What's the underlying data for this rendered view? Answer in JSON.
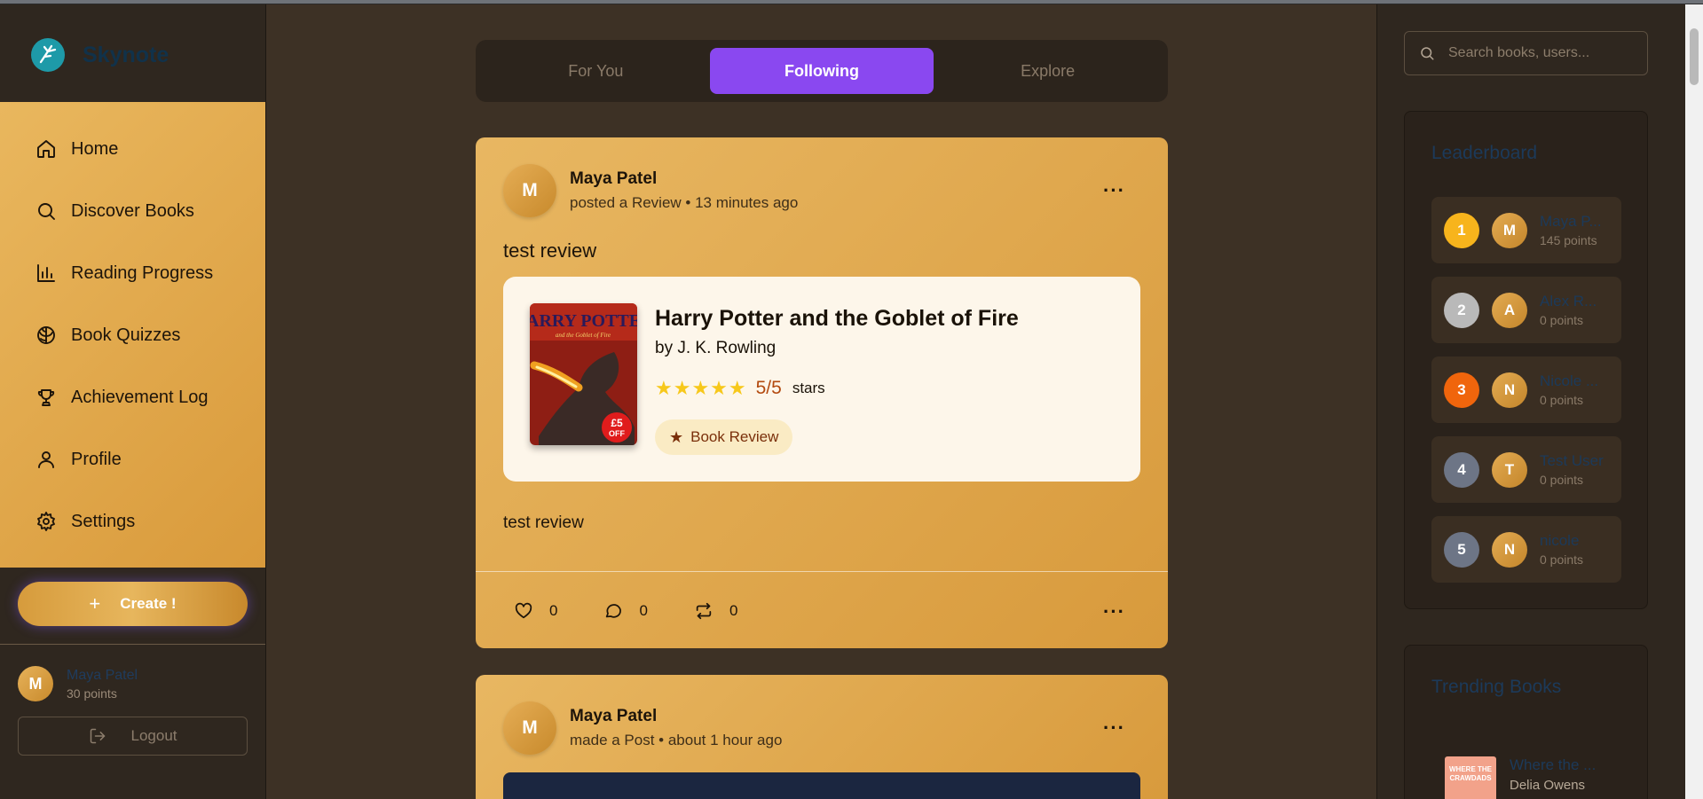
{
  "brand": {
    "name": "Skynote"
  },
  "nav": {
    "items": [
      {
        "label": "Home",
        "icon": "home-icon"
      },
      {
        "label": "Discover Books",
        "icon": "search-icon"
      },
      {
        "label": "Reading Progress",
        "icon": "bar-chart-icon"
      },
      {
        "label": "Book Quizzes",
        "icon": "brain-icon"
      },
      {
        "label": "Achievement Log",
        "icon": "trophy-icon"
      },
      {
        "label": "Profile",
        "icon": "user-icon"
      },
      {
        "label": "Settings",
        "icon": "gear-icon"
      }
    ]
  },
  "create_button": {
    "label": "Create !"
  },
  "current_user": {
    "initial": "M",
    "name": "Maya Patel",
    "points": "30 points"
  },
  "logout": {
    "label": "Logout"
  },
  "feed_tabs": [
    {
      "label": "For You",
      "active": false
    },
    {
      "label": "Following",
      "active": true
    },
    {
      "label": "Explore",
      "active": false
    }
  ],
  "posts": [
    {
      "initial": "M",
      "author": "Maya Patel",
      "subtitle": "posted a Review • 13 minutes ago",
      "title": "test review",
      "book": {
        "title": "Harry Potter and the Goblet of Fire",
        "author": "by J. K. Rowling",
        "stars": "★★★★★",
        "score": "5/5",
        "stars_label": "stars",
        "badge": "Book Review",
        "cover": {
          "top_text": "HARRY POTTER",
          "sub_text": "and the Goblet of Fire",
          "sticker_big": "£5",
          "sticker_small": "OFF"
        }
      },
      "body": "test review",
      "likes": "0",
      "comments": "0",
      "reposts": "0"
    },
    {
      "initial": "M",
      "author": "Maya Patel",
      "subtitle": "made a Post • about 1 hour ago"
    }
  ],
  "search": {
    "placeholder": "Search books, users..."
  },
  "leaderboard": {
    "title": "Leaderboard",
    "rows": [
      {
        "rank": "1",
        "initial": "M",
        "name": "Maya P...",
        "points": "145 points",
        "rank_color": "#f7b41c"
      },
      {
        "rank": "2",
        "initial": "A",
        "name": "Alex R...",
        "points": "0 points",
        "rank_color": "#b9b9b9"
      },
      {
        "rank": "3",
        "initial": "N",
        "name": "Nicole ...",
        "points": "0 points",
        "rank_color": "#f0650c"
      },
      {
        "rank": "4",
        "initial": "T",
        "name": "Test User",
        "points": "0 points",
        "rank_color": "#6d7586"
      },
      {
        "rank": "5",
        "initial": "N",
        "name": "nicole",
        "points": "0 points",
        "rank_color": "#6d7586"
      }
    ]
  },
  "trending": {
    "title": "Trending Books",
    "items": [
      {
        "title": "Where the ...",
        "author": "Delia Owens",
        "cover_text": "WHERE THE CRAWDADS"
      }
    ]
  },
  "colors": {
    "accent": "#8a48f0",
    "sidebar_gold": "#e3ab52",
    "background": "#3d3125"
  }
}
